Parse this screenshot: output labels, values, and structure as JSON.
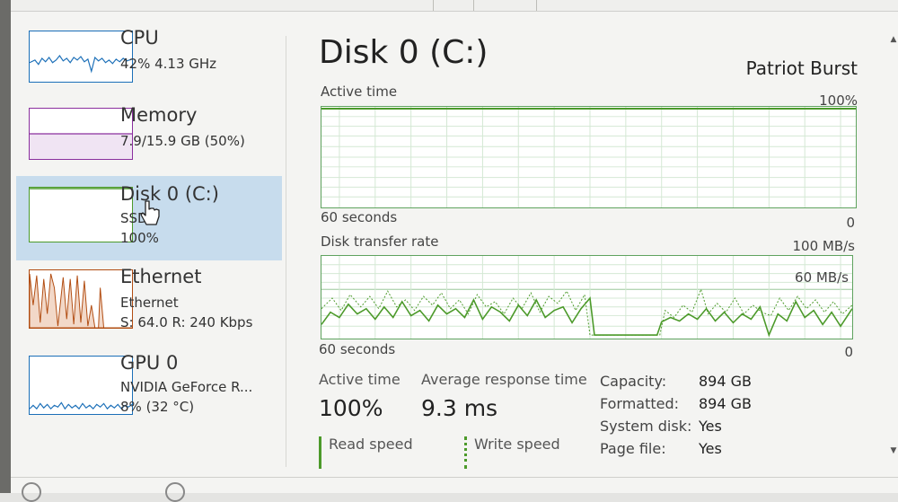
{
  "sidebar": {
    "items": [
      {
        "title": "CPU",
        "line1": "42% 4.13 GHz",
        "line2": "",
        "line3": "",
        "color": "#1b6fb8"
      },
      {
        "title": "Memory",
        "line1": "7.9/15.9 GB (50%)",
        "line2": "",
        "line3": "",
        "color": "#8a2f9e"
      },
      {
        "title": "Disk 0 (C:)",
        "line1": "SSD",
        "line2": "100%",
        "line3": "",
        "color": "#4c9a2a"
      },
      {
        "title": "Ethernet",
        "line1": "Ethernet",
        "line2": "S: 64.0 R: 240 Kbps",
        "line3": "",
        "color": "#b24d12"
      },
      {
        "title": "GPU 0",
        "line1": "NVIDIA GeForce R...",
        "line2": "8% (32 °C)",
        "line3": "",
        "color": "#1b6fb8"
      }
    ]
  },
  "main": {
    "title": "Disk 0 (C:)",
    "device": "Patriot Burst",
    "active_time_graph": {
      "label": "Active time",
      "max_label": "100%",
      "time_label": "60 seconds",
      "min_label": "0"
    },
    "transfer_graph": {
      "label": "Disk transfer rate",
      "max_label": "100 MB/s",
      "mid_label": "60 MB/s",
      "time_label": "60 seconds",
      "min_label": "0"
    },
    "stats": {
      "active_time_label": "Active time",
      "active_time_value": "100%",
      "avg_response_label": "Average response time",
      "avg_response_value": "9.3 ms",
      "read_speed_label": "Read speed",
      "write_speed_label": "Write speed"
    },
    "properties": [
      {
        "key": "Capacity:",
        "value": "894 GB"
      },
      {
        "key": "Formatted:",
        "value": "894 GB"
      },
      {
        "key": "System disk:",
        "value": "Yes"
      },
      {
        "key": "Page file:",
        "value": "Yes"
      }
    ]
  },
  "colors": {
    "disk_green": "#4c9a2a",
    "selected_bg": "#c7dced"
  }
}
